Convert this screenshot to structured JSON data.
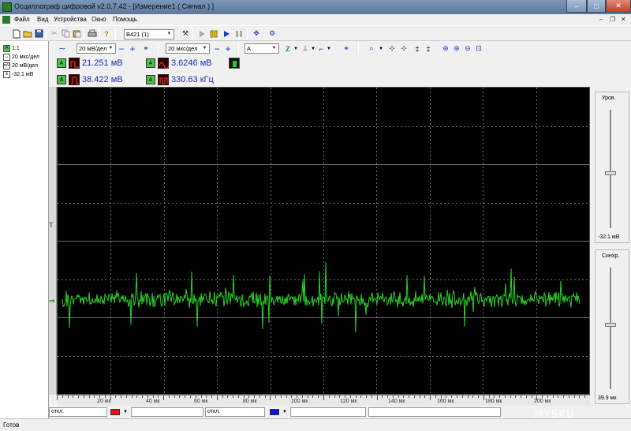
{
  "window": {
    "title": "Осциллограф цифровой v2.0.7.42 - [Измерение1 ( Сигнал ) ]",
    "min": "–",
    "max": "□",
    "close": "✕"
  },
  "menu": [
    "Файл",
    "Вид",
    "Устройства",
    "Окно",
    "Помощь"
  ],
  "mdi_controls": {
    "min": "–",
    "restore": "❐",
    "close": "✕"
  },
  "toolbar": {
    "device": "В421 (1)",
    "icons": [
      "new-icon",
      "open-icon",
      "save-icon",
      "cut-icon",
      "copy-icon",
      "paste-icon",
      "print-icon",
      "help-icon",
      "tools-icon",
      "record-icon",
      "pause-icon",
      "play-icon",
      "stop-icon",
      "settings-icon",
      "connect-icon"
    ]
  },
  "left_panel": [
    {
      "icon": "A",
      "text": "1:1"
    },
    {
      "icon": "↔",
      "text": "20 мкс/дел"
    },
    {
      "icon": "mV",
      "text": "20 мВ/дел"
    },
    {
      "icon": "±",
      "text": "-32.1 мВ"
    }
  ],
  "toolbar2": {
    "volts_div": "20 мВ/дел",
    "time_div": "20 мкс/дел",
    "channel": "A",
    "minus": "−",
    "plus": "+"
  },
  "measurements": [
    {
      "ch": "A",
      "type": "amplitude-icon",
      "value": "21.251 мВ"
    },
    {
      "ch": "A",
      "type": "rms-icon",
      "value": "3.6246 мВ"
    },
    {
      "ch": "A",
      "type": "pulse-icon",
      "value": "38.422 мВ"
    },
    {
      "ch": "A",
      "type": "frequency-icon",
      "value": "330.63 кГц"
    }
  ],
  "scope": {
    "trace_color": "#27d127",
    "grid_color": "#6a6a6a",
    "trigger_marker": "T",
    "zero_marker": "⇒"
  },
  "x_axis": {
    "labels": [
      "20 мк",
      "40 мк",
      "60 мк",
      "80 мк",
      "100 мк",
      "120 мк",
      "140 мк",
      "160 мк",
      "180 мк",
      "200 мк"
    ]
  },
  "right_panel": {
    "level_title": "Уров.",
    "level_value": "-32.1 мВ",
    "sync_title": "Синхр.",
    "sync_value": "39.9 мк"
  },
  "bottom_bar": {
    "ch1_state": "откл.",
    "ch1_color": "#e81010",
    "ch2_state": "откл.",
    "ch2_color": "#1010e0"
  },
  "status": "Готов",
  "watermark": "MYSKU"
}
